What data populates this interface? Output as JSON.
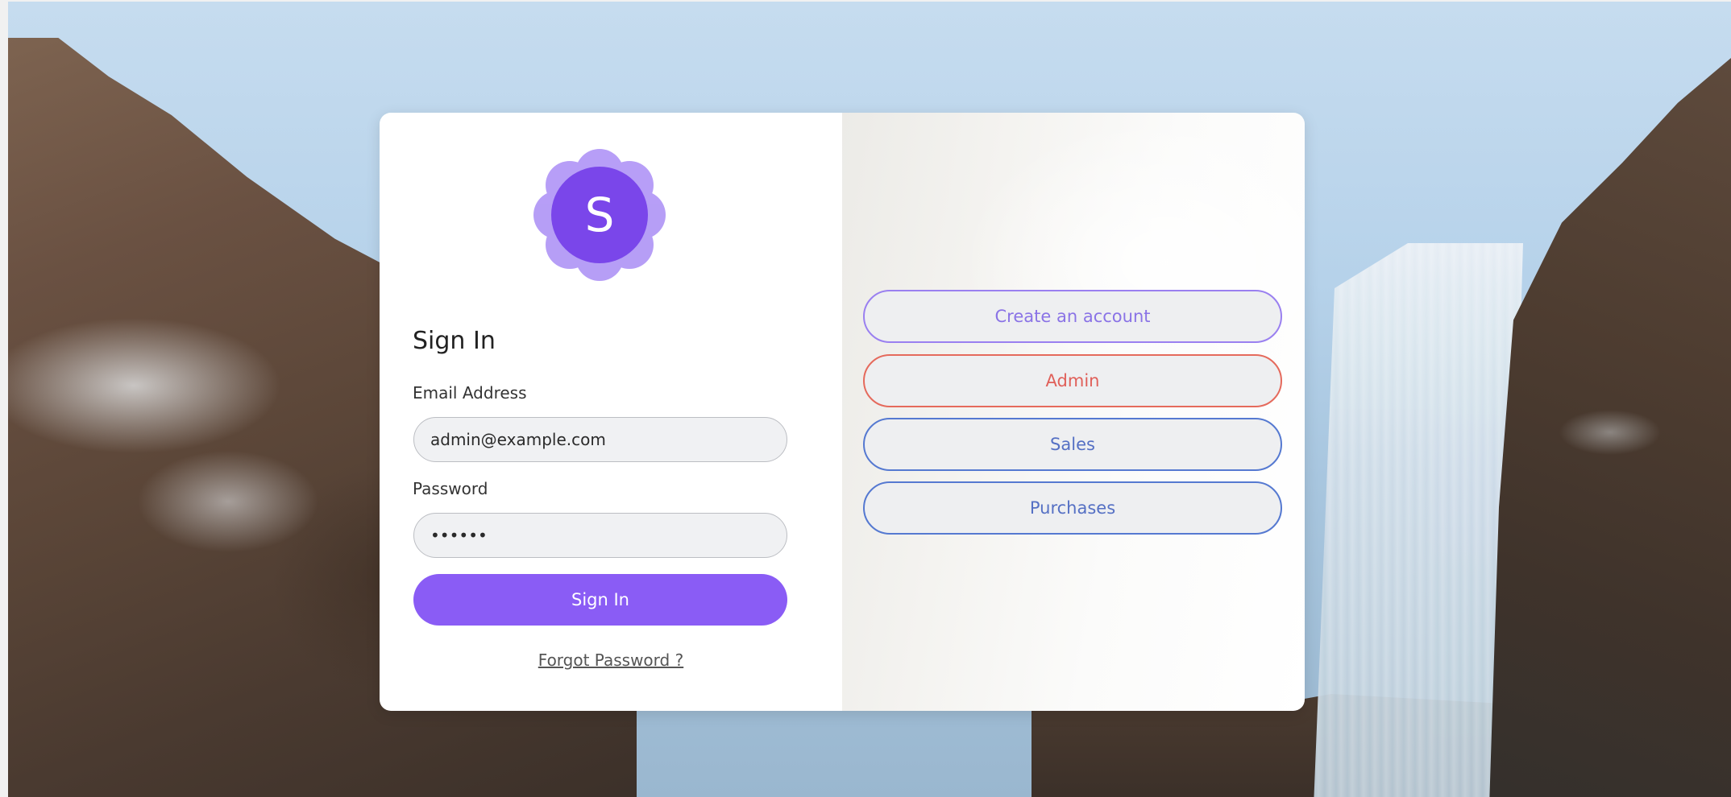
{
  "login": {
    "logo_letter": "S",
    "title": "Sign In",
    "email_label": "Email Address",
    "email_value": "admin@example.com",
    "password_label": "Password",
    "password_value": "••••••",
    "signin_button": "Sign In",
    "forgot_link": "Forgot Password ?"
  },
  "quick_access": {
    "buttons": [
      {
        "label": "Create an account"
      },
      {
        "label": "Admin"
      },
      {
        "label": "Sales"
      },
      {
        "label": "Purchases"
      }
    ]
  },
  "colors": {
    "primary": "#8a5cf5",
    "create": "#9a80f0",
    "admin": "#e0605a",
    "sales": "#5570c4",
    "purchases": "#5570c4"
  }
}
